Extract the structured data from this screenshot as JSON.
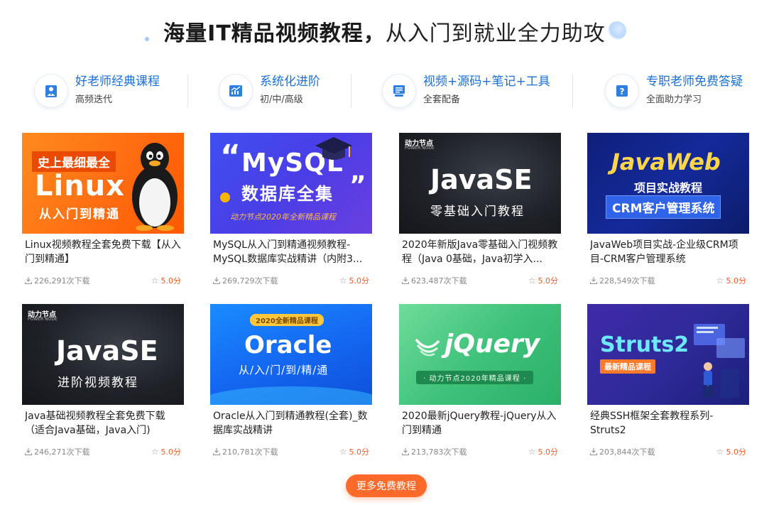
{
  "headline": {
    "strong": "海量IT精品视频教程",
    "sep": "，",
    "rest": "从入门到就业全力助攻"
  },
  "features": [
    {
      "icon": "teacher-icon",
      "title": "好老师经典课程",
      "sub": "高频迭代"
    },
    {
      "icon": "growth-chart-icon",
      "title": "系统化进阶",
      "sub": "初/中/高级"
    },
    {
      "icon": "video-code-icon",
      "title": "视频+源码+笔记+工具",
      "sub": "全套配备"
    },
    {
      "icon": "question-icon",
      "title": "专职老师免费答疑",
      "sub": "全面助力学习"
    }
  ],
  "courses": [
    {
      "title": "Linux视频教程全套免费下载【从入门到精通】",
      "downloads": "226,291次下载",
      "score": "5.0分",
      "thumb": {
        "tag": "史上最细最全",
        "main": "Linux",
        "sub": "从入门到精通"
      }
    },
    {
      "title": "MySQL从入门到精通视频教程-MySQL数据库实战精讲（内附3...",
      "downloads": "269,729次下载",
      "score": "5.0分",
      "thumb": {
        "quote_open": "“",
        "main": "MySQL",
        "line2": "数据库全集",
        "quote_close": "”",
        "sub": "动力节点2020年全新精品课程"
      }
    },
    {
      "title": "2020年新版Java零基础入门视频教程（Java 0基础，Java初学入...",
      "downloads": "623,487次下载",
      "score": "5.0分",
      "thumb": {
        "logo": "动力节点",
        "logo_sub": "POWER NODE",
        "main": "JavaSE",
        "sub": "零基础入门教程"
      }
    },
    {
      "title": "JavaWeb项目实战-企业级CRM项目-CRM客户管理系统",
      "downloads": "228,549次下载",
      "score": "5.0分",
      "thumb": {
        "main": "JavaWeb",
        "line2": "项目实战教程",
        "sub": "CRM客户管理系统"
      }
    },
    {
      "title": "Java基础视频教程全套免费下载（适合Java基础，Java入门)",
      "downloads": "246,271次下载",
      "score": "5.0分",
      "thumb": {
        "logo": "动力节点",
        "logo_sub": "POWER NODE",
        "main": "JavaSE",
        "sub": "进阶视频教程"
      }
    },
    {
      "title": "Oracle从入门到精通教程(全套)_数据库实战精讲",
      "downloads": "210,781次下载",
      "score": "5.0分",
      "thumb": {
        "tag": "2020全新精品课程",
        "main": "Oracle",
        "sub": "从/入/门/到/精/通"
      }
    },
    {
      "title": "2020最新jQuery教程-jQuery从入门到精通",
      "downloads": "213,783次下载",
      "score": "5.0分",
      "thumb": {
        "main": "jQuery",
        "sub": "· 动力节点2020年精品课程 ·"
      }
    },
    {
      "title": "经典SSH框架全套教程系列-Struts2",
      "downloads": "203,844次下载",
      "score": "5.0分",
      "thumb": {
        "main": "Struts2",
        "tag": "最新精品课程"
      }
    }
  ],
  "more_button": "更多免费教程",
  "colors": {
    "accent_blue": "#1b6fd6",
    "score_orange": "#f35c2c",
    "button_orange": "#ff6a2b"
  }
}
